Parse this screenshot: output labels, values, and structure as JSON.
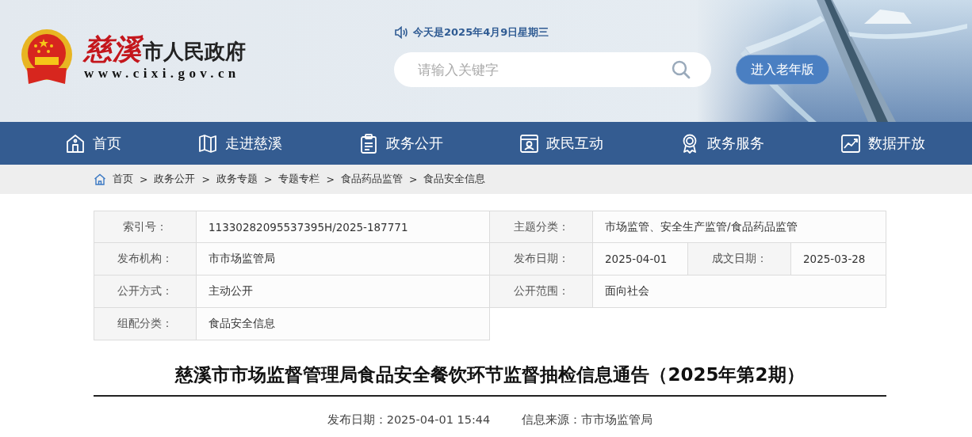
{
  "header": {
    "logo": {
      "name_red": "慈溪",
      "name": "市人民政府",
      "url": "www.cixi.gov.cn"
    },
    "date": "今天是2025年4月9日星期三",
    "search": {
      "placeholder": "请输入关键字"
    },
    "elder_button": "进入老年版"
  },
  "nav": [
    {
      "label": "首页",
      "kind": "home"
    },
    {
      "label": "走进慈溪",
      "kind": "map"
    },
    {
      "label": "政务公开",
      "kind": "clipboard"
    },
    {
      "label": "政民互动",
      "kind": "person"
    },
    {
      "label": "政务服务",
      "kind": "award"
    },
    {
      "label": "数据开放",
      "kind": "chart"
    }
  ],
  "breadcrumb": [
    {
      "label": "首页"
    },
    {
      "separator": ">",
      "label": "政务公开"
    },
    {
      "separator": ">",
      "label": "政务专题"
    },
    {
      "separator": ">",
      "label": "专题专栏"
    },
    {
      "separator": ">",
      "label": "食品药品监管"
    },
    {
      "separator": ">",
      "label": "食品安全信息"
    }
  ],
  "info_table": [
    [
      {
        "label": "索引号：",
        "value": "11330282095537395H/2025-187771"
      },
      {
        "label": "主题分类：",
        "value": "市场监管、安全生产监管/食品药品监管"
      }
    ],
    [
      {
        "label": "发布机构：",
        "value": "市市场监管局"
      },
      {
        "label": "发布日期：",
        "value": "2025-04-01"
      },
      {
        "label": "成文日期：",
        "value": "2025-03-28"
      }
    ],
    [
      {
        "label": "公开方式：",
        "value": "主动公开"
      },
      {
        "label": "公开范围：",
        "value": "面向社会"
      }
    ],
    [
      {
        "label": "组配分类：",
        "value": "食品安全信息"
      }
    ]
  ],
  "article": {
    "title": "慈溪市市场监督管理局食品安全餐饮环节监督抽检信息通告（2025年第2期）",
    "published": "发布日期：2025-04-01 15:44",
    "source": "信息来源：市市场监管局"
  }
}
